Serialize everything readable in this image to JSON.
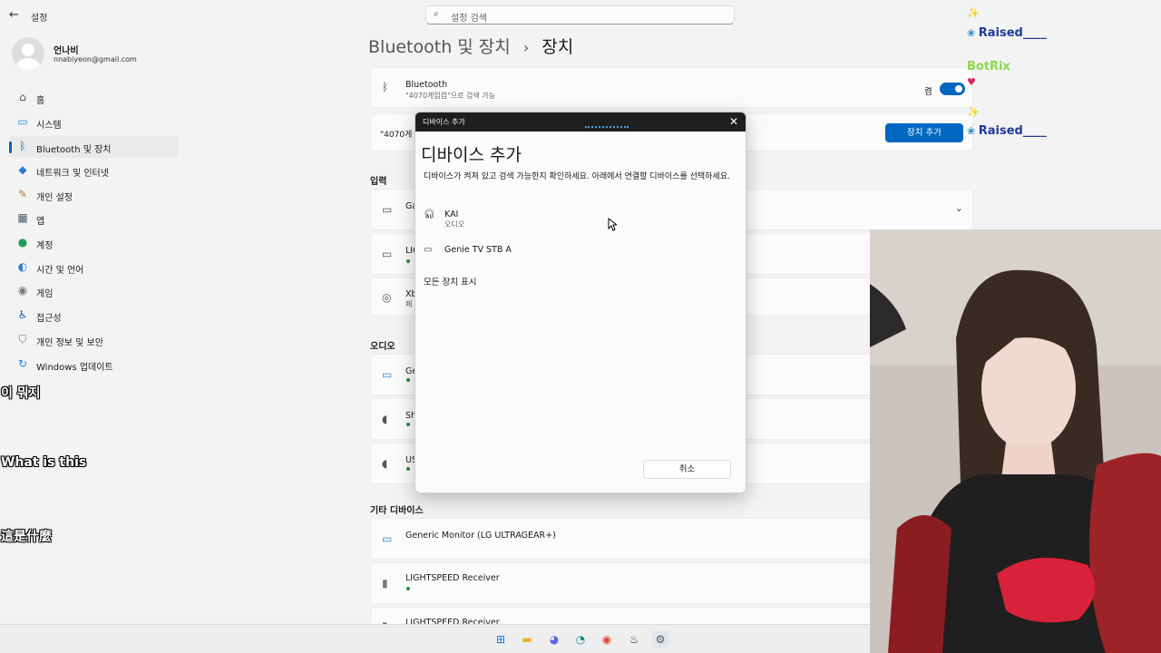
{
  "window": {
    "title": "설정",
    "back": "←",
    "minimize": "─",
    "maximize": "□",
    "search_placeholder": "설정 검색"
  },
  "profile": {
    "name": "언나비",
    "email": "nnabiyeon@gmail.com"
  },
  "sidebar": {
    "items": [
      {
        "label": "홈",
        "icon": "⌂"
      },
      {
        "label": "시스템",
        "icon": "▭"
      },
      {
        "label": "Bluetooth 및 장치",
        "icon": "ᛒ"
      },
      {
        "label": "네트워크 및 인터넷",
        "icon": "◆"
      },
      {
        "label": "개인 설정",
        "icon": "✎"
      },
      {
        "label": "앱",
        "icon": "▦"
      },
      {
        "label": "계정",
        "icon": "●"
      },
      {
        "label": "시간 및 언어",
        "icon": "◐"
      },
      {
        "label": "게임",
        "icon": "◉"
      },
      {
        "label": "접근성",
        "icon": "♿"
      },
      {
        "label": "개인 정보 및 보안",
        "icon": "⛉"
      },
      {
        "label": "Windows 업데이트",
        "icon": "↻"
      }
    ]
  },
  "overlays": [
    "이 뭐지",
    "What is this",
    "這是什麼"
  ],
  "breadcrumb": {
    "parent": "Bluetooth 및 장치",
    "sep": "›",
    "current": "장치"
  },
  "bluetooth_card": {
    "title": "Bluetooth",
    "subtitle": "\"4070게임컴\"으로 검색 가능",
    "toggle_label": "켬"
  },
  "discover_card": {
    "text": "\"4070게",
    "button": "장치 추가"
  },
  "sections": {
    "input": "입력",
    "audio": "오디오",
    "other": "기타 디바이스"
  },
  "input_devices": [
    {
      "name": "Ga",
      "icon": "▭"
    },
    {
      "name": "LIG",
      "icon": "▭"
    },
    {
      "name": "Xb",
      "sub": "페",
      "icon": "◎"
    }
  ],
  "audio_devices": [
    {
      "name": "Gene",
      "icon": "▭"
    },
    {
      "name": "Sh",
      "icon": "◖"
    },
    {
      "name": "US",
      "icon": "◖"
    }
  ],
  "other_devices": [
    {
      "name": "Generic Monitor (LG ULTRAGEAR+)",
      "icon": "▭"
    },
    {
      "name": "LIGHTSPEED Receiver",
      "icon": "▮"
    },
    {
      "name": "LIGHTSPEED Receiver",
      "icon": "▮"
    }
  ],
  "dialog": {
    "bar_title": "디바이스 추가",
    "close": "✕",
    "heading": "디바이스 추가",
    "description": "디바이스가 켜져 있고 검색 가능한지 확인하세요. 아래에서 연결할 디바이스를 선택하세요.",
    "options": [
      {
        "name": "KAI",
        "sub": "오디오",
        "icon": "🎧︎"
      },
      {
        "name": "Genie TV STB A",
        "icon": "▭"
      }
    ],
    "show_all": "모든 장치 표시",
    "cancel": "취소"
  },
  "chat": {
    "lines": [
      {
        "name": "Raised____"
      },
      {
        "name": "BotRix"
      },
      {
        "name": "Raised____"
      }
    ]
  },
  "taskbar": {
    "icons": [
      {
        "name": "start",
        "glyph": "⊞",
        "color": "#1a73e8"
      },
      {
        "name": "explorer",
        "glyph": "▬",
        "color": "#e8b62b"
      },
      {
        "name": "discord",
        "glyph": "◕",
        "color": "#5865f2"
      },
      {
        "name": "edge",
        "glyph": "◔",
        "color": "#0a8c8c"
      },
      {
        "name": "chrome",
        "glyph": "◉",
        "color": "#db4437"
      },
      {
        "name": "steam",
        "glyph": "♨",
        "color": "#1b2838"
      },
      {
        "name": "settings",
        "glyph": "⚙",
        "color": "#6b6b6b"
      }
    ]
  }
}
